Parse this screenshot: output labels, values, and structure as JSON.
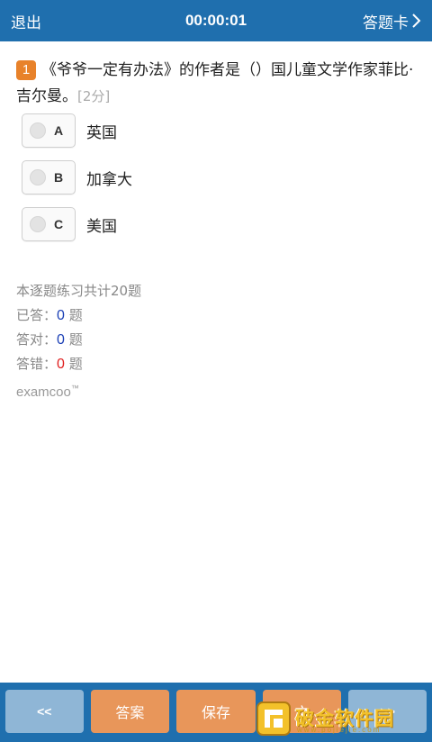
{
  "header": {
    "exit_label": "退出",
    "timer": "00:00:01",
    "answer_card_label": "答题卡"
  },
  "question": {
    "number": "1",
    "text": "《爷爷一定有办法》的作者是（）国儿童文学作家菲比·吉尔曼。",
    "score": "[2分]"
  },
  "options": [
    {
      "letter": "A",
      "text": "英国"
    },
    {
      "letter": "B",
      "text": "加拿大"
    },
    {
      "letter": "C",
      "text": "美国"
    }
  ],
  "stats": {
    "total_text": "本逐题练习共计20题",
    "answered_label": "已答：",
    "answered_value": "0",
    "correct_label": "答对：",
    "correct_value": "0",
    "wrong_label": "答错：",
    "wrong_value": "0",
    "unit": "题",
    "brand": "examcoo",
    "brand_mark": "™"
  },
  "footer": {
    "prev_label": "<<",
    "answer_label": "答案",
    "save_label": "保存",
    "text_label": "文",
    "next_label": ">>"
  },
  "watermark": {
    "text": "破金软件园",
    "url": "www.pojiejie.com"
  },
  "colors": {
    "header_bg": "#1f6fae",
    "badge": "#e8822a",
    "action_button": "#e8965a",
    "nav_button": "#8fb6d6",
    "answered_num": "#1a3fb5",
    "wrong_num": "#e02020"
  }
}
